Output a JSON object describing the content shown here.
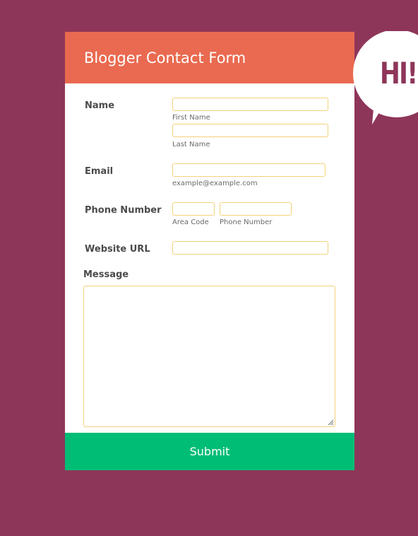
{
  "form": {
    "title": "Blogger Contact Form",
    "name": {
      "label": "Name",
      "first": {
        "value": "",
        "caption": "First Name"
      },
      "last": {
        "value": "",
        "caption": "Last Name"
      }
    },
    "email": {
      "label": "Email",
      "value": "",
      "caption": "example@example.com"
    },
    "phone": {
      "label": "Phone Number",
      "area": {
        "value": "",
        "caption": "Area Code"
      },
      "number": {
        "value": "",
        "caption": "Phone Number"
      }
    },
    "website": {
      "label": "Website URL",
      "value": ""
    },
    "message": {
      "label": "Message",
      "value": ""
    },
    "submit_label": "Submit"
  },
  "badge": {
    "text": "HI!"
  },
  "colors": {
    "background": "#8e3659",
    "header": "#e96a50",
    "submit": "#00bd76",
    "field_border": "#f2d27a"
  }
}
